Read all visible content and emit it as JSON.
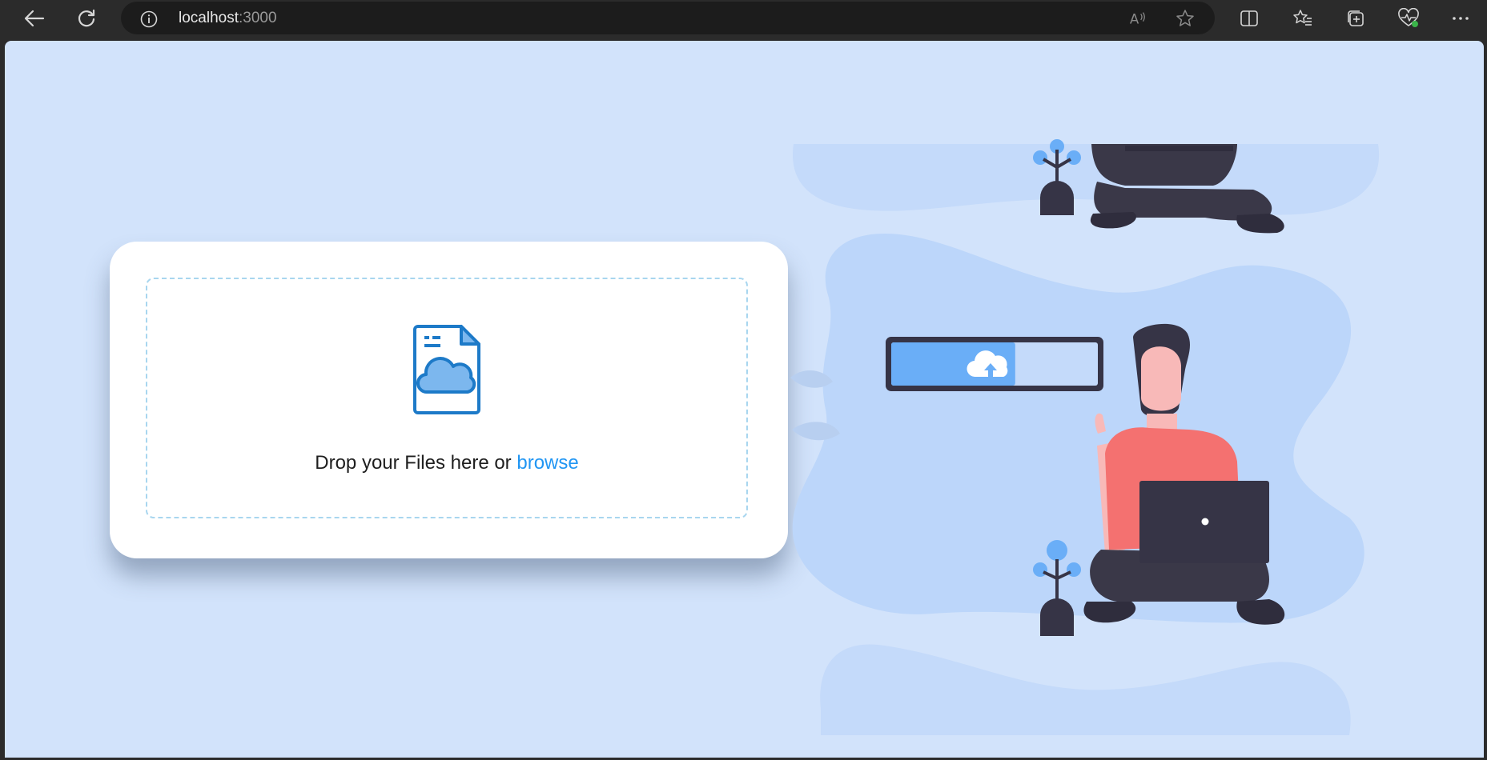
{
  "browser": {
    "url_host": "localhost",
    "url_port": ":3000",
    "icons": [
      "back-arrow-icon",
      "refresh-icon",
      "site-info-icon",
      "read-aloud-icon",
      "favorite-star-icon",
      "split-screen-icon",
      "favorites-icon",
      "collections-icon",
      "browser-essentials-icon",
      "more-menu-icon"
    ]
  },
  "upload": {
    "prompt": "Drop your Files here or",
    "browse_label": "browse"
  },
  "illustration": {
    "progress_fraction": 0.6,
    "colors": {
      "blob": "#bcd6fa",
      "progress_fill": "#6aaef7",
      "track": "#363446",
      "shirt": "#f47170",
      "skin": "#f8b9b8",
      "pants": "#3a3848"
    }
  },
  "colors": {
    "page_bg": "#d2e3fb",
    "card_bg": "#ffffff",
    "dash_border": "#a8d6ef",
    "link": "#2196f3",
    "icon_blue": "#1d7ac8"
  }
}
